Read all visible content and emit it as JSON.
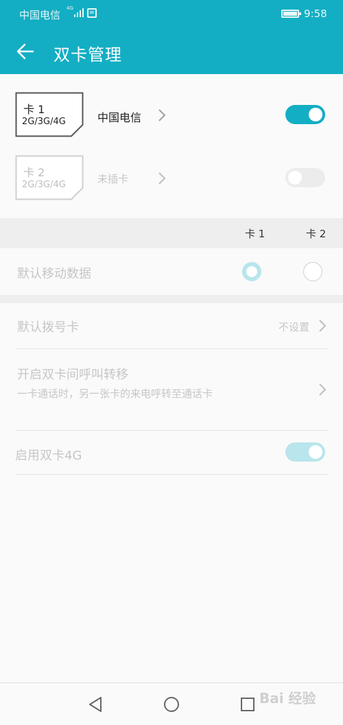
{
  "status_bar": {
    "carrier": "中国电信",
    "network": "4G",
    "time": "9:58",
    "icons": [
      "signal-icon",
      "sim-icon",
      "battery-icon"
    ]
  },
  "app_bar": {
    "title": "双卡管理",
    "back_icon": "arrow-left-icon"
  },
  "sim_slots": [
    {
      "card_label": "卡 1",
      "generations": "2G/3G/4G",
      "carrier": "中国电信",
      "enabled": true
    },
    {
      "card_label": "卡 2",
      "generations": "2G/3G/4G",
      "carrier": "未插卡",
      "enabled": false
    }
  ],
  "column_headers": [
    "卡 1",
    "卡 2"
  ],
  "default_data": {
    "label": "默认移动数据",
    "selected": "卡 1"
  },
  "default_dial": {
    "label": "默认拨号卡",
    "value": "不设置"
  },
  "call_forward": {
    "title": "开启双卡间呼叫转移",
    "description": "一卡通话时，另一张卡的来电呼转至通话卡"
  },
  "dual_4g": {
    "label": "启用双卡4G",
    "enabled": true
  },
  "watermark": "Bai 经验",
  "colors": {
    "accent": "#13aec3",
    "accent_light": "#b8e6ec",
    "disabled_text": "#c6c6c6"
  },
  "nav_bar": {
    "icons": [
      "back-triangle-icon",
      "home-circle-icon",
      "recents-square-icon"
    ]
  }
}
